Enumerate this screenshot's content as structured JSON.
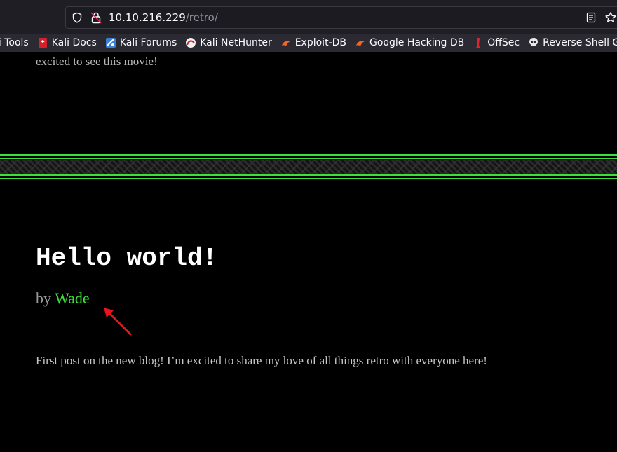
{
  "browser": {
    "url_host": "10.10.216.229",
    "url_path": "/retro/",
    "bookmarks": [
      {
        "label": "li Tools",
        "icon": "kali-tools-icon"
      },
      {
        "label": "Kali Docs",
        "icon": "kali-docs-icon"
      },
      {
        "label": "Kali Forums",
        "icon": "kali-forums-icon"
      },
      {
        "label": "Kali NetHunter",
        "icon": "kali-nethunter-icon"
      },
      {
        "label": "Exploit-DB",
        "icon": "exploit-db-icon"
      },
      {
        "label": "Google Hacking DB",
        "icon": "google-hacking-db-icon"
      },
      {
        "label": "OffSec",
        "icon": "offsec-icon"
      },
      {
        "label": "Reverse Shell Genera",
        "icon": "skull-icon"
      }
    ]
  },
  "page": {
    "previous_excerpt": "excited to see this movie!",
    "post": {
      "title": "Hello world!",
      "by": "by",
      "author": "Wade",
      "body": "First post on the new blog! I’m excited to share my love of all things retro with everyone here!"
    },
    "colors": {
      "accent_green": "#3de03a",
      "annotation_arrow": "#e8141c"
    }
  }
}
